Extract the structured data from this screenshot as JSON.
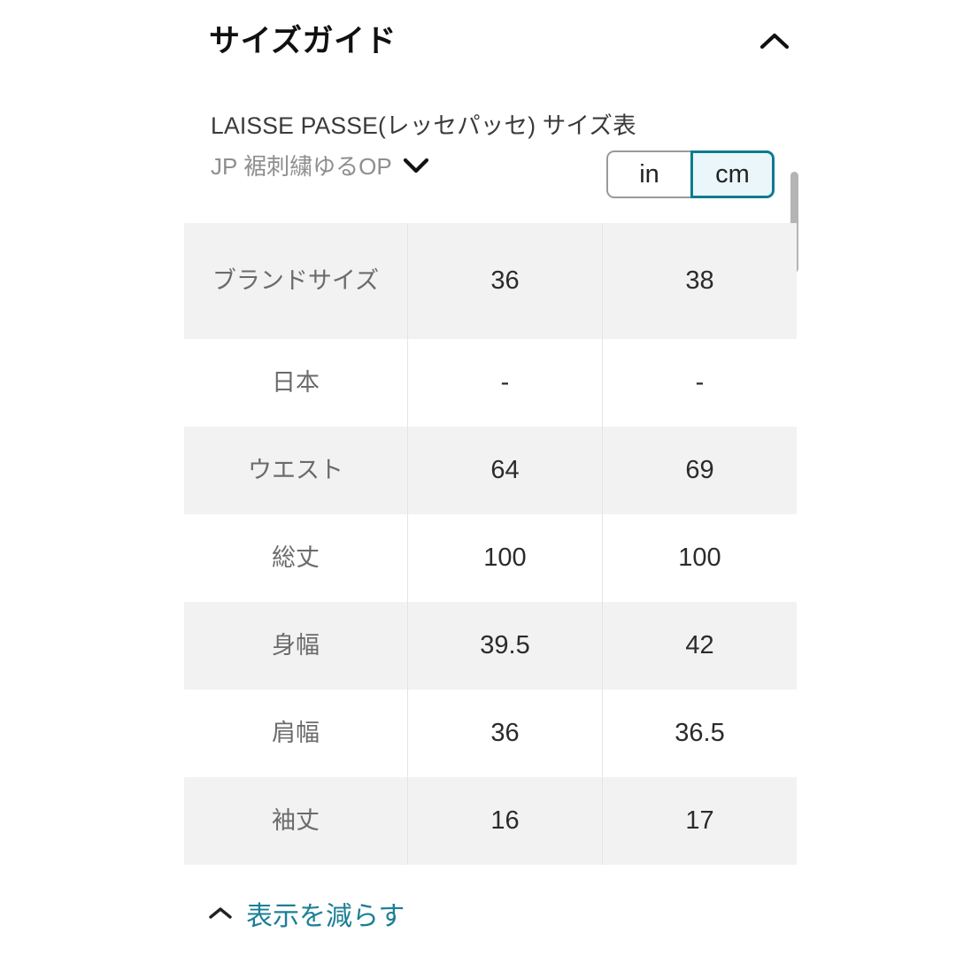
{
  "header": {
    "title": "サイズガイド",
    "collapse_icon": "chevron-up-icon"
  },
  "caption": "LAISSE PASSE(レッセパッセ) サイズ表",
  "variant": {
    "label": "JP 裾刺繍ゆるOP",
    "icon": "chevron-down-icon"
  },
  "unit_toggle": {
    "options": [
      "in",
      "cm"
    ],
    "in_label": "in",
    "cm_label": "cm",
    "selected": "cm",
    "selected_border": "#0f7b8f",
    "selected_fill": "#eaf6fa",
    "unselected_border": "#9a9a9a"
  },
  "table": {
    "row_label_header": "ブランドサイズ",
    "size_columns": [
      "36",
      "38"
    ],
    "rows": [
      {
        "label": "日本",
        "values": [
          "-",
          "-"
        ]
      },
      {
        "label": "ウエスト",
        "values": [
          "64",
          "69"
        ]
      },
      {
        "label": "総丈",
        "values": [
          "100",
          "100"
        ]
      },
      {
        "label": "身幅",
        "values": [
          "39.5",
          "42"
        ]
      },
      {
        "label": "肩幅",
        "values": [
          "36",
          "36.5"
        ]
      },
      {
        "label": "袖丈",
        "values": [
          "16",
          "17"
        ]
      }
    ]
  },
  "footer": {
    "less_label": "表示を減らす",
    "less_icon": "chevron-up-icon",
    "link_color": "#1b7f97"
  },
  "scrollbar": {
    "thumb_color": "#b4b4b4"
  }
}
